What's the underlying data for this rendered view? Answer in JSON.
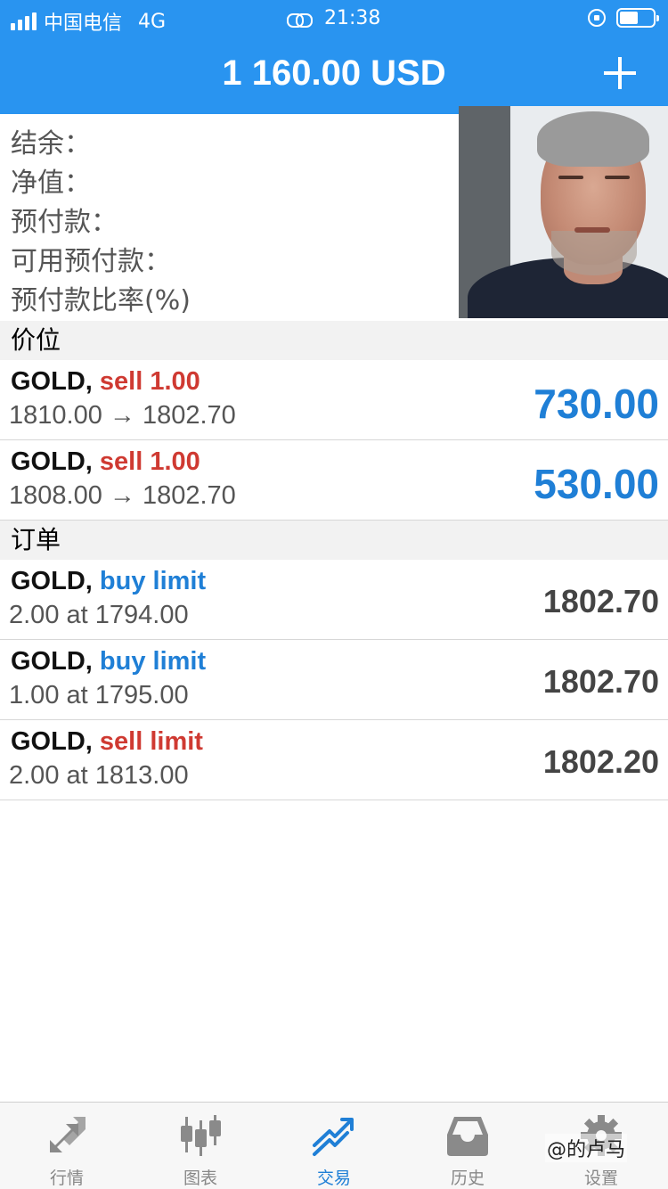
{
  "status_bar": {
    "carrier": "中国电信",
    "network": "4G",
    "time": "21:38"
  },
  "header": {
    "title": "1 160.00 USD",
    "add_icon": "plus-icon"
  },
  "account_summary": {
    "rows": [
      "结余：",
      "净值：",
      "预付款：",
      "可用预付款：",
      "预付款比率(%)"
    ]
  },
  "positions": {
    "header": "价位",
    "items": [
      {
        "symbol": "GOLD,",
        "side": "sell 1.00",
        "side_color": "#cf3a32",
        "detail": "1810.00 → 1802.70",
        "profit": "730.00"
      },
      {
        "symbol": "GOLD,",
        "side": "sell 1.00",
        "side_color": "#cf3a32",
        "detail": "1808.00 → 1802.70",
        "profit": "530.00"
      }
    ]
  },
  "orders": {
    "header": "订单",
    "items": [
      {
        "symbol": "GOLD,",
        "side": "buy limit",
        "side_color": "#1f7fd6",
        "detail": "2.00 at 1794.00",
        "price": "1802.70"
      },
      {
        "symbol": "GOLD,",
        "side": "buy limit",
        "side_color": "#1f7fd6",
        "detail": "1.00 at 1795.00",
        "price": "1802.70"
      },
      {
        "symbol": "GOLD,",
        "side": "sell limit",
        "side_color": "#cf3a32",
        "detail": "2.00 at 1813.00",
        "price": "1802.20"
      }
    ]
  },
  "tab_bar": {
    "tabs": [
      {
        "label": "行情",
        "icon": "quotes-arrows-icon",
        "active": false
      },
      {
        "label": "图表",
        "icon": "candlestick-chart-icon",
        "active": false
      },
      {
        "label": "交易",
        "icon": "trade-trend-icon",
        "active": true
      },
      {
        "label": "历史",
        "icon": "history-tray-icon",
        "active": false
      },
      {
        "label": "设置",
        "icon": "gear-icon",
        "active": false
      }
    ]
  },
  "watermark": "@的卢马",
  "colors": {
    "header_bg": "#2994f0",
    "sell": "#cf3a32",
    "buy": "#1f7fd6",
    "profit": "#1f7fd6",
    "section_bg": "#f2f2f2"
  }
}
